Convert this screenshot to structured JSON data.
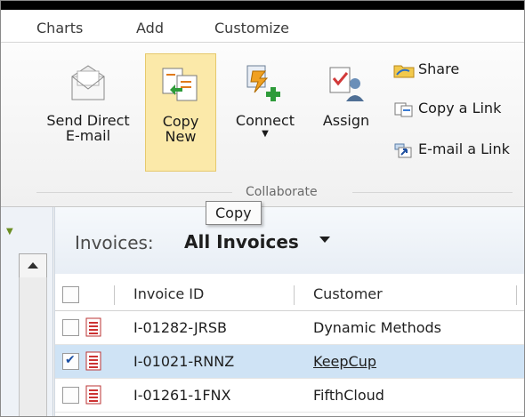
{
  "menu_tabs": [
    "Charts",
    "Add",
    "Customize"
  ],
  "ribbon": {
    "send_direct_email": {
      "line1": "Send Direct",
      "line2": "E-mail"
    },
    "copy_new": {
      "line1": "Copy",
      "line2": "New"
    },
    "connect": {
      "label": "Connect"
    },
    "assign": {
      "label": "Assign"
    },
    "share": "Share",
    "copy_link": "Copy a Link",
    "email_link": "E-mail a Link",
    "group_label": "Collaborate"
  },
  "tooltip": "Copy",
  "view": {
    "label": "Invoices:",
    "name": "All Invoices"
  },
  "grid": {
    "columns": [
      "Invoice ID",
      "Customer"
    ],
    "rows": [
      {
        "invoice_id": "I-01282-JRSB",
        "customer": "Dynamic Methods",
        "checked": false,
        "selected": false
      },
      {
        "invoice_id": "I-01021-RNNZ",
        "customer": "KeepCup",
        "checked": true,
        "selected": true
      },
      {
        "invoice_id": "I-01261-1FNX",
        "customer": "FifthCloud",
        "checked": false,
        "selected": false
      }
    ]
  },
  "colors": {
    "selected_button_bg": "#fbe9a9",
    "selected_row_bg": "#cfe3f5"
  }
}
